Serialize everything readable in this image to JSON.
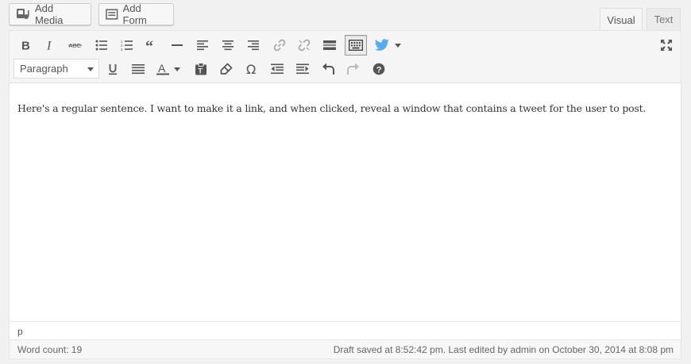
{
  "media_buttons": {
    "add_media": "Add Media",
    "add_form": "Add Form"
  },
  "tabs": {
    "visual": "Visual",
    "text": "Text"
  },
  "toolbar": {
    "format_select": "Paragraph",
    "icons_row1": [
      "bold-icon",
      "italic-icon",
      "strikethrough-icon",
      "bullet-list-icon",
      "numbered-list-icon",
      "blockquote-icon",
      "horizontal-rule-icon",
      "align-left-icon",
      "align-center-icon",
      "align-right-icon",
      "link-icon",
      "unlink-icon",
      "read-more-icon",
      "toolbar-toggle-icon",
      "twitter-icon",
      "fullscreen-icon"
    ],
    "icons_row2": [
      "underline-icon",
      "justify-icon",
      "text-color-icon",
      "paste-as-text-icon",
      "clear-formatting-icon",
      "special-character-icon",
      "outdent-icon",
      "indent-icon",
      "undo-icon",
      "redo-icon",
      "help-icon"
    ],
    "accent_twitter": "#55acee"
  },
  "content": {
    "text": "Here's a regular sentence. I want to make it a link, and when clicked, reveal a window that contains a tweet for the user to post."
  },
  "path": "p",
  "status": {
    "word_count": "Word count: 19",
    "draft_info": "Draft saved at 8:52:42 pm. Last edited by admin on October 30, 2014 at 8:08 pm"
  }
}
